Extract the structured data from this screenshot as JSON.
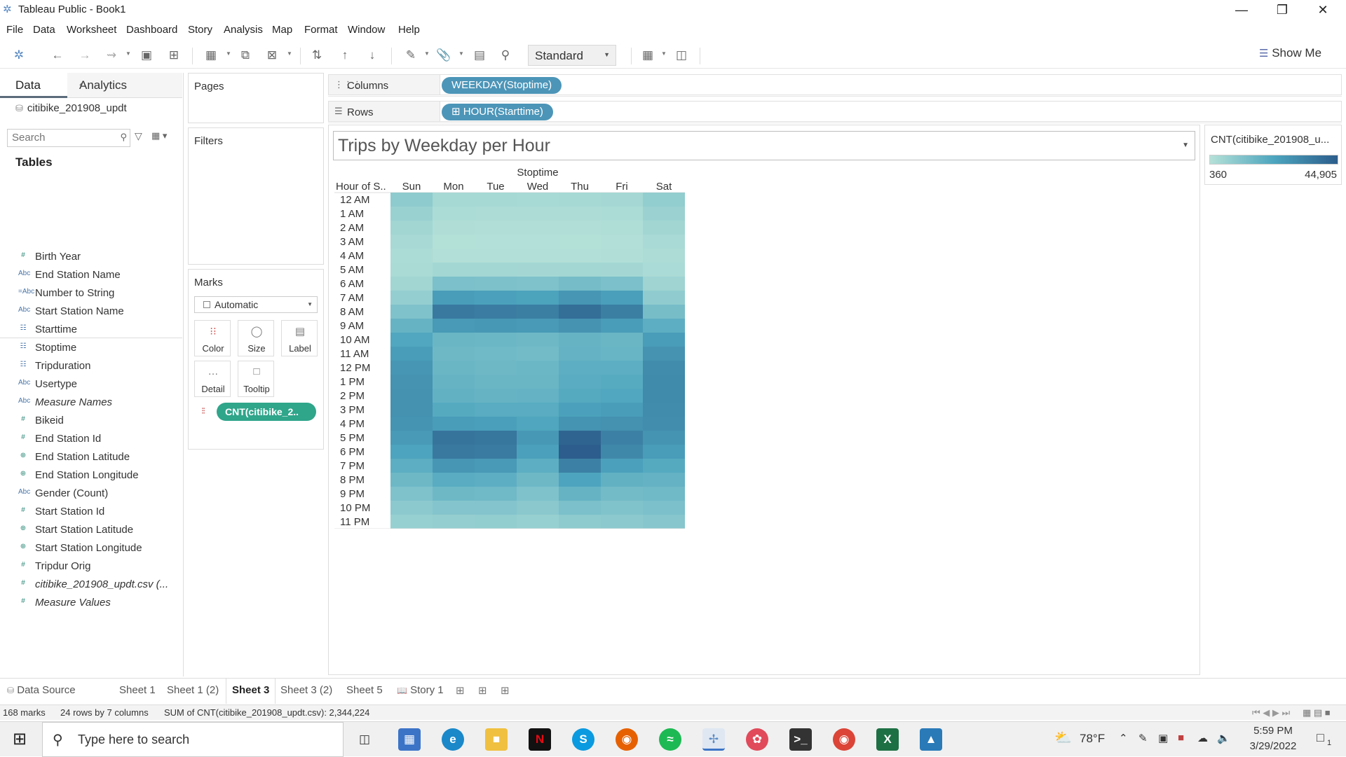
{
  "window": {
    "title": "Tableau Public - Book1"
  },
  "menu": [
    "File",
    "Data",
    "Worksheet",
    "Dashboard",
    "Story",
    "Analysis",
    "Map",
    "Format",
    "Window",
    "Help"
  ],
  "toolbar": {
    "fit_select": "Standard",
    "show_me": "Show Me"
  },
  "data_pane": {
    "tab_data": "Data",
    "tab_analytics": "Analytics",
    "datasource": "citibike_201908_updt",
    "search_placeholder": "Search",
    "tables_header": "Tables",
    "dimensions": [
      {
        "icon": "#",
        "label": "Birth Year"
      },
      {
        "icon": "Abc",
        "label": "End Station Name"
      },
      {
        "icon": "=Abc",
        "label": "Number to String"
      },
      {
        "icon": "Abc",
        "label": "Start Station Name"
      },
      {
        "icon": "cal",
        "label": "Starttime"
      },
      {
        "icon": "cal",
        "label": "Stoptime"
      },
      {
        "icon": "cal",
        "label": "Tripduration"
      },
      {
        "icon": "Abc",
        "label": "Usertype"
      },
      {
        "icon": "Abc",
        "label": "Measure Names"
      }
    ],
    "measures": [
      {
        "icon": "#",
        "label": "Bikeid"
      },
      {
        "icon": "#",
        "label": "End Station Id"
      },
      {
        "icon": "globe",
        "label": "End Station Latitude"
      },
      {
        "icon": "globe",
        "label": "End Station Longitude"
      },
      {
        "icon": "Abc",
        "label": "Gender (Count)"
      },
      {
        "icon": "#",
        "label": "Start Station Id"
      },
      {
        "icon": "globe",
        "label": "Start Station Latitude"
      },
      {
        "icon": "globe",
        "label": "Start Station Longitude"
      },
      {
        "icon": "#",
        "label": "Tripdur Orig"
      },
      {
        "icon": "#",
        "label": "citibike_201908_updt.csv (..."
      },
      {
        "icon": "#",
        "label": "Measure Values"
      }
    ]
  },
  "cards": {
    "pages": "Pages",
    "filters": "Filters",
    "marks": "Marks",
    "mark_type": "Automatic",
    "buttons": [
      "Color",
      "Size",
      "Label",
      "Detail",
      "Tooltip"
    ],
    "measure_pill": "CNT(citibike_2.."
  },
  "shelves": {
    "columns_label": "Columns",
    "columns_pill": "WEEKDAY(Stoptime)",
    "rows_label": "Rows",
    "rows_pill": "⊞ HOUR(Starttime)"
  },
  "viz": {
    "title": "Trips by Weekday per Hour"
  },
  "legend": {
    "title": "CNT(citibike_201908_u...",
    "min": "360",
    "max": "44,905",
    "low_color": "#b5e1d8",
    "high_color": "#2c5d8c"
  },
  "chart_data": {
    "type": "heatmap",
    "title": "Trips by Weekday per Hour",
    "column_header": "Stoptime",
    "row_header": "Hour of S..",
    "columns": [
      "Sun",
      "Mon",
      "Tue",
      "Wed",
      "Thu",
      "Fri",
      "Sat"
    ],
    "rows": [
      "12 AM",
      "1 AM",
      "2 AM",
      "3 AM",
      "4 AM",
      "5 AM",
      "6 AM",
      "7 AM",
      "8 AM",
      "9 AM",
      "10 AM",
      "11 AM",
      "12 PM",
      "1 PM",
      "2 PM",
      "3 PM",
      "4 PM",
      "5 PM",
      "6 PM",
      "7 PM",
      "8 PM",
      "9 PM",
      "10 PM",
      "11 PM"
    ],
    "color_range": [
      360,
      44905
    ],
    "values": [
      [
        9500,
        4000,
        3800,
        3600,
        3800,
        4200,
        8500
      ],
      [
        7000,
        2400,
        2200,
        2200,
        2300,
        2600,
        6500
      ],
      [
        5000,
        1500,
        1300,
        1300,
        1400,
        1700,
        4800
      ],
      [
        3500,
        900,
        800,
        800,
        900,
        1100,
        3300
      ],
      [
        2400,
        1100,
        1000,
        1000,
        1100,
        1200,
        2300
      ],
      [
        2800,
        4500,
        4500,
        4300,
        4600,
        4400,
        2700
      ],
      [
        5000,
        14000,
        13500,
        13000,
        15500,
        14000,
        5500
      ],
      [
        8000,
        27000,
        26000,
        25500,
        29000,
        26500,
        9000
      ],
      [
        13000,
        37000,
        36000,
        35500,
        40000,
        35500,
        15000
      ],
      [
        19000,
        28000,
        28500,
        28000,
        30000,
        27000,
        21000
      ],
      [
        24000,
        18000,
        17500,
        17000,
        19000,
        18000,
        27000
      ],
      [
        27000,
        17000,
        16500,
        16000,
        19500,
        18500,
        30000
      ],
      [
        29000,
        18000,
        17000,
        17500,
        21000,
        21000,
        32000
      ],
      [
        30000,
        19000,
        18000,
        18000,
        22000,
        22500,
        32500
      ],
      [
        30500,
        20000,
        19000,
        19500,
        23000,
        24000,
        32500
      ],
      [
        30500,
        23000,
        22000,
        22000,
        26000,
        27000,
        32000
      ],
      [
        29500,
        27000,
        26500,
        24500,
        29500,
        30500,
        31500
      ],
      [
        28000,
        38500,
        38000,
        28500,
        43000,
        35000,
        29500
      ],
      [
        25000,
        37000,
        36500,
        26000,
        44905,
        33000,
        27000
      ],
      [
        21000,
        29000,
        28000,
        21000,
        35000,
        26000,
        23000
      ],
      [
        17000,
        22000,
        21000,
        17000,
        25000,
        20000,
        19500
      ],
      [
        13000,
        17000,
        16500,
        13000,
        19000,
        16000,
        16500
      ],
      [
        10000,
        12000,
        12000,
        10500,
        14000,
        12500,
        14000
      ],
      [
        7500,
        8000,
        8500,
        7500,
        9500,
        10000,
        11500
      ]
    ]
  },
  "sheet_tabs": {
    "data_source": "Data Source",
    "tabs": [
      "Sheet 1",
      "Sheet 1 (2)",
      "Sheet 3",
      "Sheet 3 (2)",
      "Sheet 5",
      "Story 1"
    ],
    "active": "Sheet 3"
  },
  "status": {
    "marks": "168 marks",
    "dims": "24 rows by 7 columns",
    "sum": "SUM of CNT(citibike_201908_updt.csv): 2,344,224"
  },
  "taskbar": {
    "search_placeholder": "Type here to search",
    "weather": "78°F",
    "time": "5:59 PM",
    "date": "3/29/2022",
    "notifications": "1"
  }
}
